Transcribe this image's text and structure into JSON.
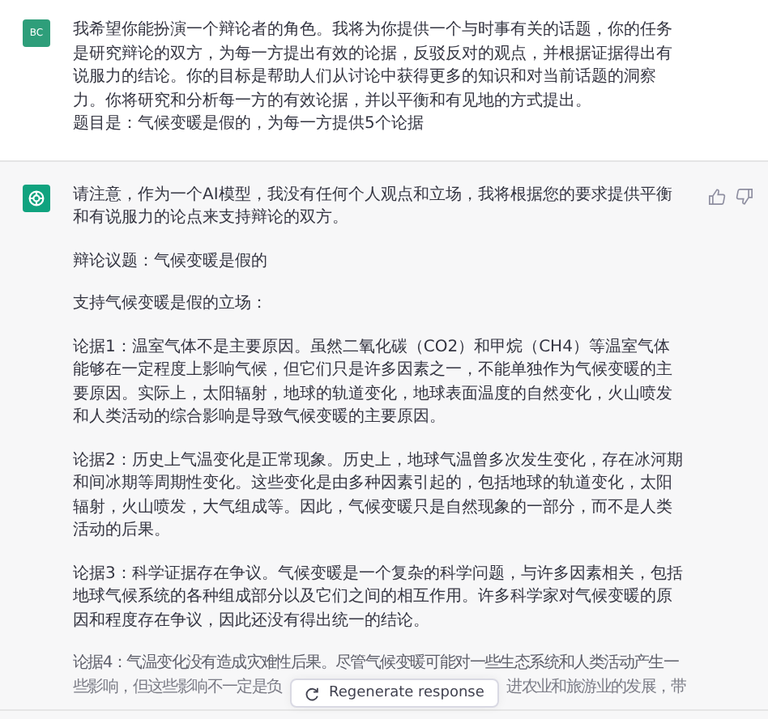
{
  "messages": [
    {
      "kind": "user",
      "avatar": "BC",
      "paragraphs": [
        {
          "kind": "plain",
          "text": "我希望你能扮演一个辩论者的角色。我将为你提供一个与时事有关的话题，你的任务是研究辩论的双方，为每一方提出有效的论据，反驳反对的观点，并根据证据得出有说服力的结论。你的目标是帮助人们从讨论中获得更多的知识和对当前话题的洞察力。你将研究和分析每一方的有效论据，并以平衡和有见地的方式提出。"
        },
        {
          "kind": "plain",
          "text": "题目是：气候变暖是假的，为每一方提供5个论据"
        }
      ]
    },
    {
      "kind": "assistant",
      "paragraphs": [
        {
          "kind": "plain",
          "text": "请注意，作为一个AI模型，我没有任何个人观点和立场，我将根据您的要求提供平衡和有说服力的论点来支持辩论的双方。"
        },
        {
          "kind": "plain",
          "text": "辩论议题：气候变暖是假的"
        },
        {
          "kind": "plain",
          "text": "支持气候变暖是假的立场："
        },
        {
          "kind": "plain",
          "text": "论据1：温室气体不是主要原因。虽然二氧化碳（CO2）和甲烷（CH4）等温室气体能够在一定程度上影响气候，但它们只是许多因素之一，不能单独作为气候变暖的主要原因。实际上，太阳辐射，地球的轨道变化，地球表面温度的自然变化，火山喷发和人类活动的综合影响是导致气候变暖的主要原因。"
        },
        {
          "kind": "plain",
          "text": "论据2：历史上气温变化是正常现象。历史上，地球气温曾多次发生变化，存在冰河期和间冰期等周期性变化。这些变化是由多种因素引起的，包括地球的轨道变化，太阳辐射，火山喷发，大气组成等。因此，气候变暖只是自然现象的一部分，而不是人类活动的后果。"
        },
        {
          "kind": "plain",
          "text": "论据3：科学证据存在争议。气候变暖是一个复杂的科学问题，与许多因素相关，包括地球气候系统的各种组成部分以及它们之间的相互作用。许多科学家对气候变暖的原因和程度存在争议，因此还没有得出统一的结论。"
        },
        {
          "kind": "cut",
          "text": "论据4：气温变化没有造成灾难性后果。尽管气候变暖可能对一些生态系统和人类活动产生一",
          "left": "些影响，但这些影响不一定是负",
          "right": "进农业和旅游业的发展，带"
        }
      ]
    }
  ],
  "regenerate": {
    "label": "Regenerate response"
  }
}
